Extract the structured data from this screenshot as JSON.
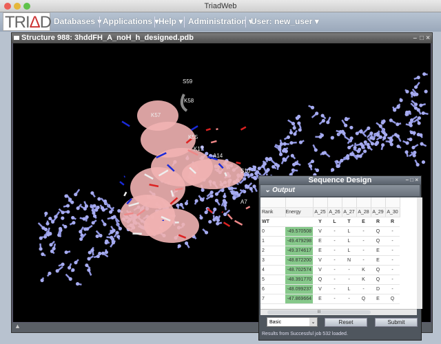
{
  "app_title": "TriadWeb",
  "logo": {
    "text": "TRIAD"
  },
  "menu": [
    {
      "label": "Databases"
    },
    {
      "label": "Applications"
    },
    {
      "label": "Help"
    },
    {
      "label": "Administration"
    },
    {
      "label": "User: new_user"
    }
  ],
  "structure_window": {
    "title": "Structure 988: 3hddFH_A_noH_h_designed.pdb",
    "bottom_icon": "collapse-arrow-icon"
  },
  "molecule_labels": [
    "S59",
    "K58",
    "K57",
    "K55",
    "K17",
    "A14",
    "S10",
    "A7"
  ],
  "sequence_design": {
    "title": "Sequence Design",
    "section": "Output",
    "columns": [
      "Rank",
      "Energy",
      "A_25",
      "A_26",
      "A_27",
      "A_28",
      "A_29",
      "A_30"
    ],
    "wt": {
      "rank": "WT",
      "energy": "",
      "residues": [
        "Y",
        "L",
        "T",
        "E",
        "R",
        "R"
      ]
    },
    "rows": [
      {
        "rank": "0",
        "energy": "-49.570508",
        "residues": [
          "V",
          "-",
          "L",
          "-",
          "Q",
          "-"
        ]
      },
      {
        "rank": "1",
        "energy": "-49.479298",
        "residues": [
          "E",
          "-",
          "L",
          "-",
          "Q",
          "-"
        ]
      },
      {
        "rank": "2",
        "energy": "-49.374617",
        "residues": [
          "E",
          "-",
          "L",
          "-",
          "E",
          "-"
        ]
      },
      {
        "rank": "3",
        "energy": "-48.872200",
        "residues": [
          "V",
          "-",
          "N",
          "-",
          "E",
          "-"
        ]
      },
      {
        "rank": "4",
        "energy": "-48.702574",
        "residues": [
          "V",
          "-",
          "-",
          "K",
          "Q",
          "-"
        ]
      },
      {
        "rank": "5",
        "energy": "-48.391770",
        "residues": [
          "Q",
          "-",
          "-",
          "K",
          "Q",
          "-"
        ]
      },
      {
        "rank": "6",
        "energy": "-48.099237",
        "residues": [
          "V",
          "-",
          "L",
          "-",
          "D",
          "-"
        ]
      },
      {
        "rank": "7",
        "energy": "-47.869664",
        "residues": [
          "E",
          "-",
          "-",
          "Q",
          "E",
          "Q"
        ]
      }
    ],
    "hscroll_label": "III",
    "mode_select": "Basic",
    "reset_label": "Reset",
    "submit_label": "Submit",
    "status": "Results from Successful job 532 loaded.",
    "energy_color": "#86c88a"
  }
}
